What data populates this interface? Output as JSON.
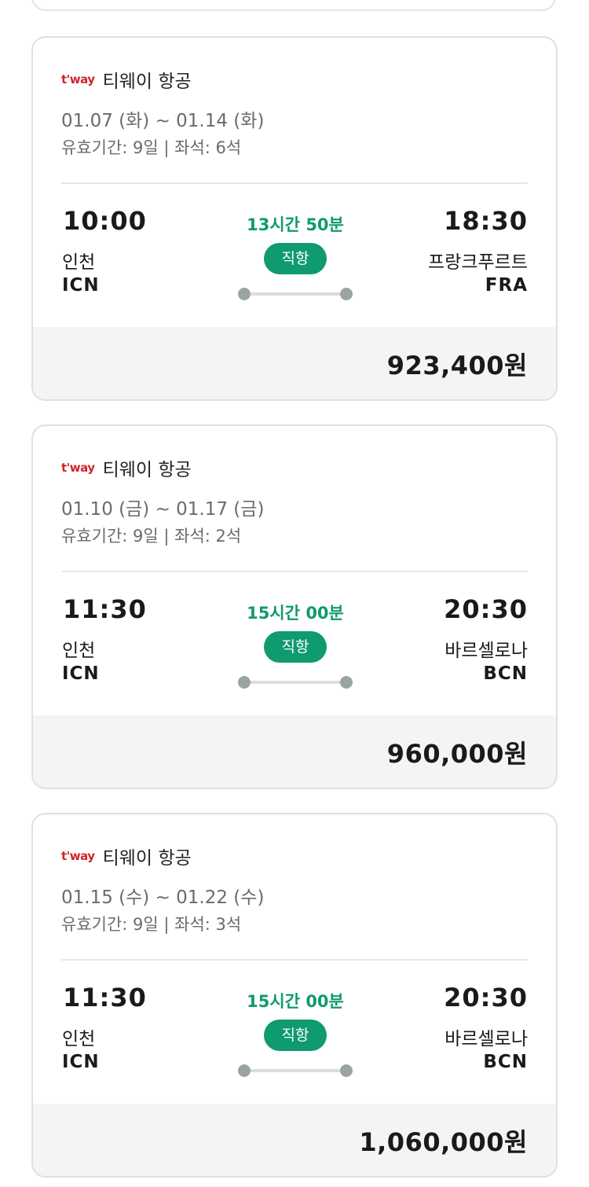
{
  "flights": [
    {
      "airline_logo": "t'way",
      "airline_name": "티웨이 항공",
      "dates": "01.07 (화) ~ 01.14 (화)",
      "validity": "유효기간: 9일 | 좌석: 6석",
      "departure": {
        "time": "10:00",
        "city": "인천",
        "code": "ICN"
      },
      "arrival": {
        "time": "18:30",
        "city": "프랑크푸르트",
        "code": "FRA"
      },
      "duration": "13시간 50분",
      "badge": "직항",
      "price": "923,400원"
    },
    {
      "airline_logo": "t'way",
      "airline_name": "티웨이 항공",
      "dates": "01.10 (금) ~ 01.17 (금)",
      "validity": "유효기간: 9일 | 좌석: 2석",
      "departure": {
        "time": "11:30",
        "city": "인천",
        "code": "ICN"
      },
      "arrival": {
        "time": "20:30",
        "city": "바르셀로나",
        "code": "BCN"
      },
      "duration": "15시간 00분",
      "badge": "직항",
      "price": "960,000원"
    },
    {
      "airline_logo": "t'way",
      "airline_name": "티웨이 항공",
      "dates": "01.15 (수) ~ 01.22 (수)",
      "validity": "유효기간: 9일 | 좌석: 3석",
      "departure": {
        "time": "11:30",
        "city": "인천",
        "code": "ICN"
      },
      "arrival": {
        "time": "20:30",
        "city": "바르셀로나",
        "code": "BCN"
      },
      "duration": "15시간 00분",
      "badge": "직항",
      "price": "1,060,000원"
    }
  ],
  "colors": {
    "accent_green": "#0f9a70",
    "logo_red": "#d0242b",
    "secondary_text": "#6b6b6b",
    "price_bar_bg": "#f4f4f4"
  }
}
